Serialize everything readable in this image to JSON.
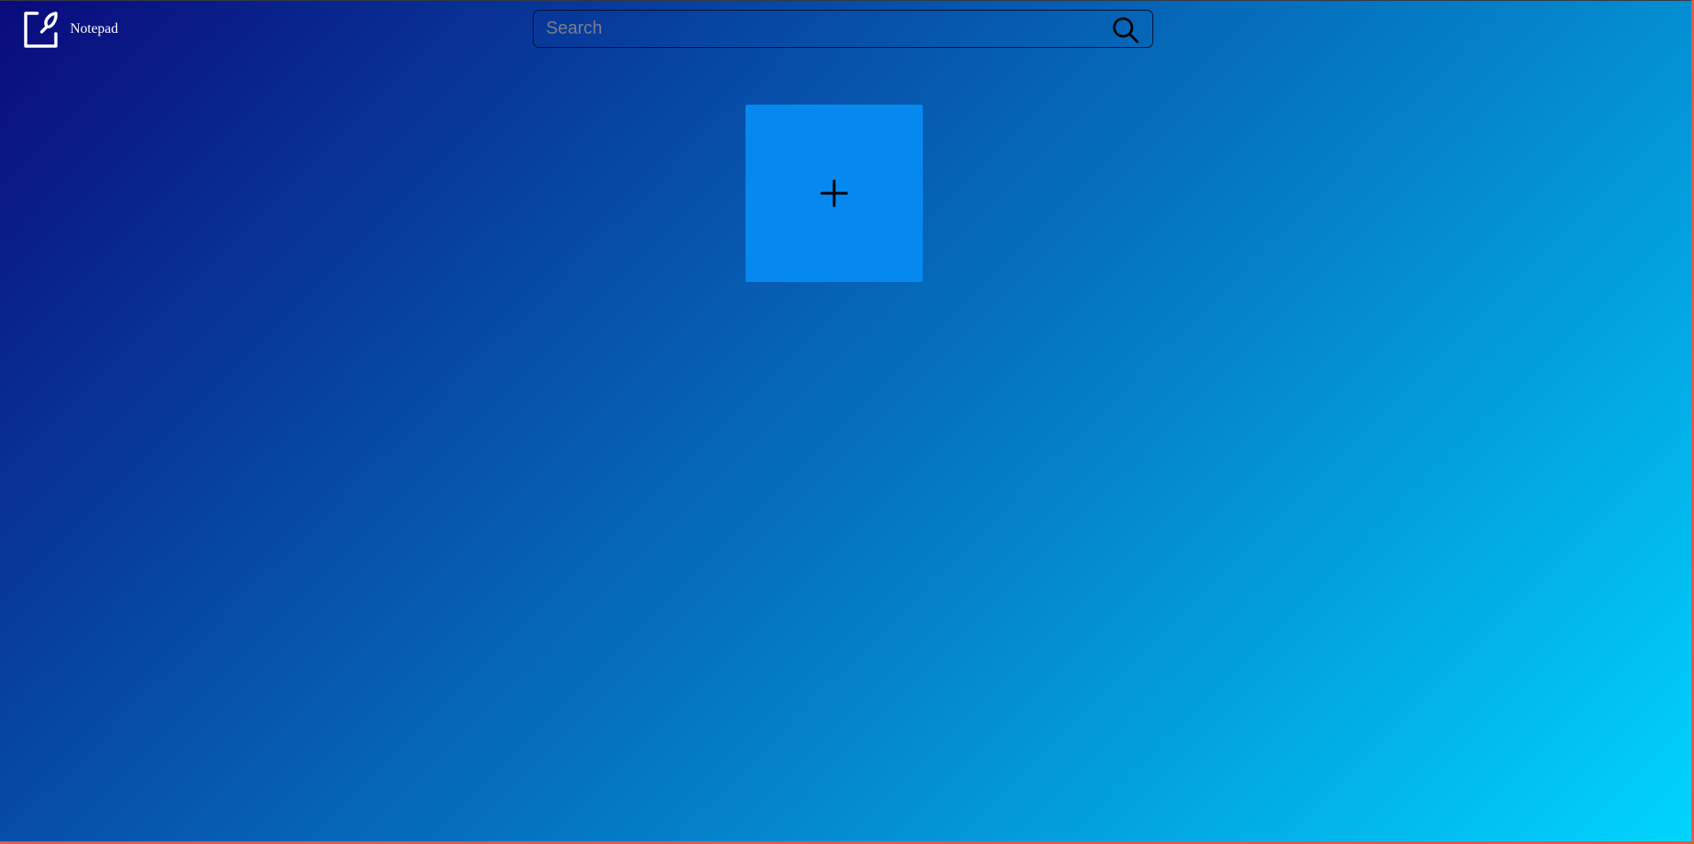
{
  "app": {
    "name": "Notepad",
    "logo_icon": "note-edit-icon"
  },
  "search": {
    "placeholder": "Search",
    "value": "",
    "icon": "search-icon"
  },
  "notes": {
    "add_icon": "plus-icon",
    "items": []
  },
  "colors": {
    "gradient_start": "#0a0a7c",
    "gradient_end": "#00d4ff",
    "tile": "#0589ee",
    "border": "#e05a50"
  }
}
